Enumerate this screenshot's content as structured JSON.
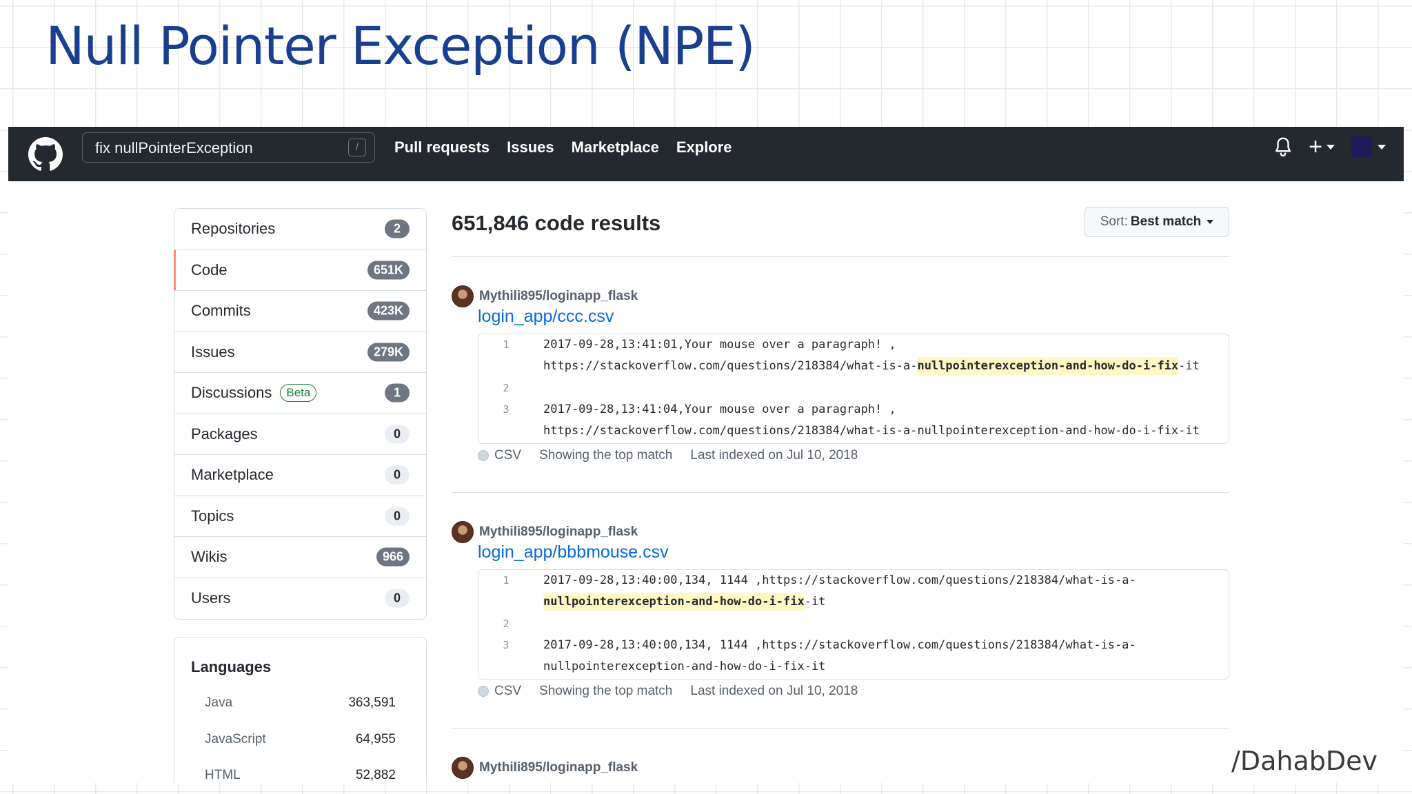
{
  "slide": {
    "title": "Null Pointer Exception (NPE)",
    "watermark": "/DahabDev"
  },
  "header": {
    "search": {
      "value": "fix nullPointerException",
      "shortcut": "/"
    },
    "nav": [
      "Pull requests",
      "Issues",
      "Marketplace",
      "Explore"
    ],
    "icons": [
      "github-logo",
      "bell-icon",
      "plus-icon",
      "avatar"
    ],
    "plus": "+"
  },
  "sidebar": {
    "filters": [
      {
        "label": "Repositories",
        "count": "2",
        "selected": false
      },
      {
        "label": "Code",
        "count": "651K",
        "selected": true
      },
      {
        "label": "Commits",
        "count": "423K",
        "selected": false
      },
      {
        "label": "Issues",
        "count": "279K",
        "selected": false
      },
      {
        "label": "Discussions",
        "badge": "Beta",
        "count": "1",
        "selected": false
      },
      {
        "label": "Packages",
        "count": "0",
        "selected": false
      },
      {
        "label": "Marketplace",
        "count": "0",
        "selected": false
      },
      {
        "label": "Topics",
        "count": "0",
        "selected": false
      },
      {
        "label": "Wikis",
        "count": "966",
        "selected": false
      },
      {
        "label": "Users",
        "count": "0",
        "selected": false
      }
    ],
    "languages": {
      "title": "Languages",
      "items": [
        {
          "name": "Java",
          "count": "363,591"
        },
        {
          "name": "JavaScript",
          "count": "64,955"
        },
        {
          "name": "HTML",
          "count": "52,882"
        }
      ]
    }
  },
  "main": {
    "results_title": "651,846 code results",
    "sort": {
      "label": "Sort:",
      "value": "Best match"
    },
    "results": [
      {
        "repo": "Mythili895/loginapp_flask",
        "file": "login_app/ccc.csv",
        "lines": [
          {
            "n": "1",
            "pre": "2017-09-28,13:41:01,Your mouse over a paragraph! ,",
            "hl": "",
            "post": ""
          },
          {
            "n": "",
            "pre": "https://stackoverflow.com/questions/218384/what-is-a-",
            "hl": "nullpointerexception-and-how-do-i-fix",
            "post": "-it"
          },
          {
            "n": "2",
            "pre": "",
            "hl": "",
            "post": ""
          },
          {
            "n": "3",
            "pre": "2017-09-28,13:41:04,Your mouse over a paragraph! ,",
            "hl": "",
            "post": ""
          },
          {
            "n": "",
            "pre": "https://stackoverflow.com/questions/218384/what-is-a-nullpointerexception-and-how-do-i-fix-it",
            "hl": "",
            "post": ""
          }
        ],
        "language": "CSV",
        "match_note": "Showing the top match",
        "indexed": "Last indexed on Jul 10, 2018"
      },
      {
        "repo": "Mythili895/loginapp_flask",
        "file": "login_app/bbbmouse.csv",
        "lines": [
          {
            "n": "1",
            "pre": "2017-09-28,13:40:00,134, 1144 ,https://stackoverflow.com/questions/218384/what-is-a-",
            "hl": "",
            "post": ""
          },
          {
            "n": "",
            "pre": "",
            "hl": "nullpointerexception-and-how-do-i-fix",
            "post": "-it"
          },
          {
            "n": "2",
            "pre": "",
            "hl": "",
            "post": ""
          },
          {
            "n": "3",
            "pre": "2017-09-28,13:40:00,134, 1144 ,https://stackoverflow.com/questions/218384/what-is-a-",
            "hl": "",
            "post": ""
          },
          {
            "n": "",
            "pre": "nullpointerexception-and-how-do-i-fix-it",
            "hl": "",
            "post": ""
          }
        ],
        "language": "CSV",
        "match_note": "Showing the top match",
        "indexed": "Last indexed on Jul 10, 2018"
      },
      {
        "repo": "Mythili895/loginapp_flask"
      }
    ]
  }
}
